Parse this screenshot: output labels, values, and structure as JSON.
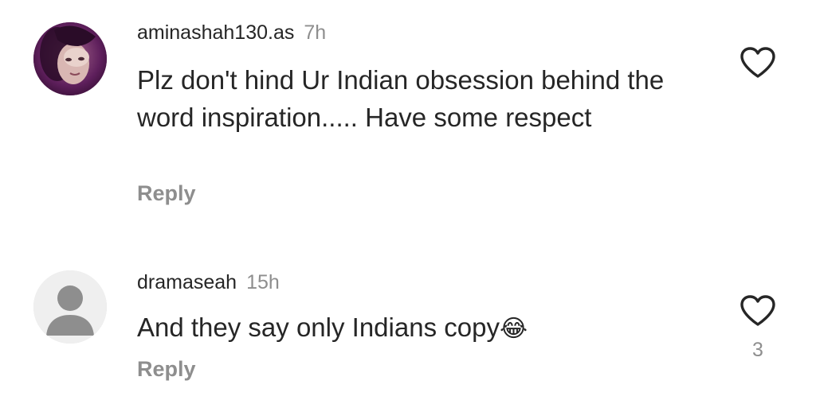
{
  "comments": [
    {
      "username": "aminashah130.as",
      "time": "7h",
      "text": "Plz don't hind Ur Indian obsession behind the word  inspiration..... Have some respect",
      "reply_label": "Reply",
      "avatar_icon": "user-photo",
      "like_icon": "heart-outline-icon"
    },
    {
      "username": "dramaseah",
      "time": "15h",
      "text": "And they say only Indians copy",
      "emoji": "😂",
      "reply_label": "Reply",
      "like_count": "3",
      "avatar_icon": "default-user-icon",
      "like_icon": "heart-outline-icon"
    }
  ],
  "colors": {
    "text": "#262626",
    "muted": "#8e8e8e",
    "default_avatar_bg": "#dbdbdb",
    "default_avatar_fg": "#8e8e8e"
  }
}
